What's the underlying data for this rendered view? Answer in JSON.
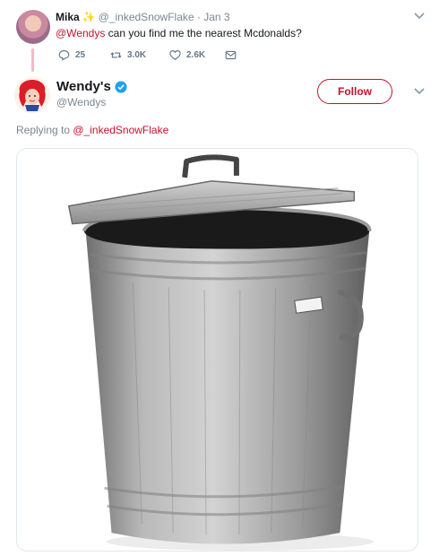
{
  "reply_tweet": {
    "author_name": "Mika",
    "sparkle": "✨",
    "handle": "@_inkedSnowFlake",
    "separator": "·",
    "date": "Jan 3",
    "mention": "@Wendys",
    "text": " can you find me the nearest Mcdonalds?",
    "reply_count": "25",
    "retweet_count": "3.0K",
    "like_count": "2.6K"
  },
  "main_tweet": {
    "author_name": "Wendy's",
    "handle": "@Wendys",
    "follow_label": "Follow",
    "replying_prefix": "Replying to ",
    "replying_to": "@_inkedSnowFlake"
  },
  "icons": [
    "reply-icon",
    "retweet-icon",
    "like-icon",
    "message-icon",
    "chevron-down-icon",
    "verified-badge-icon"
  ],
  "colors": {
    "brand_red": "#c8102e",
    "verified_blue": "#1da1f2",
    "muted": "#7a8691"
  }
}
